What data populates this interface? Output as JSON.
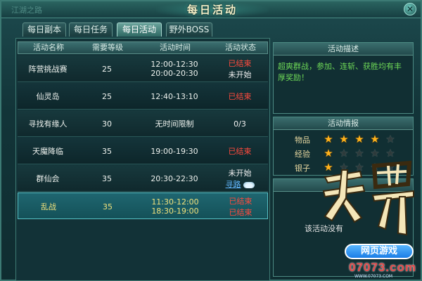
{
  "window": {
    "title": "每日活动",
    "dim_subtitle": "江湖之路"
  },
  "tabs": [
    {
      "label": "每日副本",
      "active": false
    },
    {
      "label": "每日任务",
      "active": false
    },
    {
      "label": "每日活动",
      "active": true
    },
    {
      "label": "野外BOSS",
      "active": false
    }
  ],
  "table": {
    "headers": [
      "活动名称",
      "需要等级",
      "活动时间",
      "活动状态"
    ],
    "rows": [
      {
        "name": "阵营挑战赛",
        "level": "25",
        "time": [
          "12:00-12:30",
          "20:00-20:30"
        ],
        "status": [
          "已结束",
          "未开始"
        ],
        "status_kind": [
          "ended",
          "pending"
        ]
      },
      {
        "name": "仙灵岛",
        "level": "25",
        "time": [
          "12:40-13:10"
        ],
        "status": [
          "已结束"
        ],
        "status_kind": [
          "ended"
        ]
      },
      {
        "name": "寻找有缘人",
        "level": "30",
        "time": [
          "无时间限制"
        ],
        "status": [
          "0/3"
        ],
        "status_kind": [
          "pending"
        ]
      },
      {
        "name": "天魔降临",
        "level": "35",
        "time": [
          "19:00-19:30"
        ],
        "status": [
          "已结束"
        ],
        "status_kind": [
          "ended"
        ]
      },
      {
        "name": "群仙会",
        "level": "35",
        "time": [
          "20:30-22:30"
        ],
        "status": [
          "未开始"
        ],
        "status_kind": [
          "pending"
        ],
        "link": "寻路"
      },
      {
        "name": "乱战",
        "level": "35",
        "time": [
          "11:30-12:00",
          "18:30-19:00"
        ],
        "status": [
          "已结束",
          "已结束"
        ],
        "status_kind": [
          "ended",
          "ended"
        ],
        "selected": true
      }
    ]
  },
  "description": {
    "header": "活动描述",
    "text": "超爽群战，参加、连斩、获胜均有丰厚奖励！"
  },
  "rewards": {
    "header": "活动情报",
    "items": [
      {
        "label": "物品",
        "stars": 4,
        "max": 5
      },
      {
        "label": "经验",
        "stars": 1,
        "max": 5
      },
      {
        "label": "银子",
        "stars": 1,
        "max": 5
      }
    ]
  },
  "bottom_panel": {
    "text": "该活动没有"
  },
  "colors": {
    "ended": "#ff4a3d",
    "pending": "#f2f2f2",
    "selected_text": "#f1e27c",
    "desc_text": "#6ed857",
    "star_on": "#ffb21c"
  },
  "watermark": {
    "top": "网页游戏",
    "bottom": "07073.com",
    "sub": "WWW.07073.COM"
  }
}
